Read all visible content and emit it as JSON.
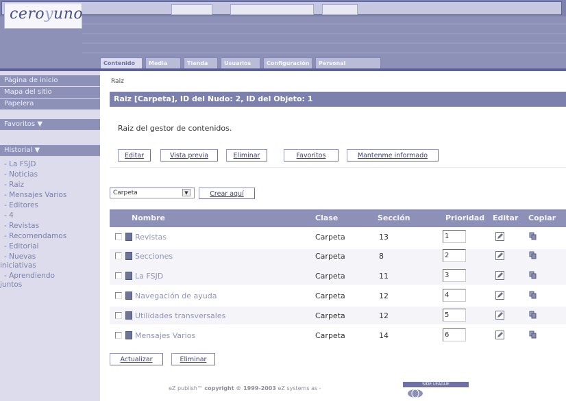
{
  "header": {
    "logo": {
      "brand_a": "cero",
      "brand_b": "y",
      "brand_c": "uno"
    }
  },
  "tabs": [
    {
      "label": "Contenido"
    },
    {
      "label": "Media"
    },
    {
      "label": "Tienda"
    },
    {
      "label": "Usuarios"
    },
    {
      "label": "Configuración"
    },
    {
      "label": "Personal"
    }
  ],
  "sidebar": {
    "top_items": [
      {
        "label": "Página de inicio"
      },
      {
        "label": "Mapa del sitio"
      },
      {
        "label": "Papelera"
      }
    ],
    "favorites_header": "Favoritos ▼",
    "history_header": "Historial ▼",
    "history_items": [
      {
        "label": "- La FSJD"
      },
      {
        "label": "- Noticias"
      },
      {
        "label": "- Raiz"
      },
      {
        "label": "- Mensajes Varios"
      },
      {
        "label": "- Editores"
      },
      {
        "label": "- 4"
      },
      {
        "label": "- Revistas"
      },
      {
        "label": "- Recomendamos"
      },
      {
        "label": "- Editorial"
      },
      {
        "label": "- Nuevas"
      },
      {
        "label": "iniciativas"
      },
      {
        "label": "- Aprendiendo"
      },
      {
        "label": "juntos"
      }
    ]
  },
  "main": {
    "breadcrumb": "Raiz",
    "path_title": "Raiz [Carpeta], ID del Nudo: 2, ID del Objeto: 1",
    "description": "Raiz del gestor de contenidos.",
    "buttons": {
      "edit": "Editar",
      "preview": "Vista previa",
      "delete": "Eliminar",
      "favorites": "Favoritos",
      "notify": "Mantenme informado"
    },
    "create": {
      "select_value": "Carpeta",
      "button": "Crear aquí"
    }
  },
  "table": {
    "headers": {
      "name": "Nombre",
      "class": "Clase",
      "section": "Sección",
      "priority": "Prioridad",
      "edit": "Editar",
      "copy": "Copiar"
    },
    "rows": [
      {
        "name": "Revistas",
        "clase": "Carpeta",
        "seccion": "13",
        "prioridad": "1"
      },
      {
        "name": "Secciones",
        "clase": "Carpeta",
        "seccion": "8",
        "prioridad": "2"
      },
      {
        "name": "La FSJD",
        "clase": "Carpeta",
        "seccion": "11",
        "prioridad": "3"
      },
      {
        "name": "Navegación de ayuda",
        "clase": "Carpeta",
        "seccion": "12",
        "prioridad": "4"
      },
      {
        "name": "Utilidades transversales",
        "clase": "Carpeta",
        "seccion": "12",
        "prioridad": "5"
      },
      {
        "name": "Mensajes Varios",
        "clase": "Carpeta",
        "seccion": "14",
        "prioridad": "6"
      }
    ],
    "actions": {
      "update": "Actualizar",
      "delete": "Eliminar"
    }
  },
  "footer": {
    "text_a": "eZ publish™ ",
    "text_b": "copyright © 1999-2003",
    "text_c": " eZ systems as - ",
    "logo_bar": "SIDE LEAGUE"
  },
  "colors": {
    "header": "#8d91b8",
    "path_bar": "#7b80ad",
    "sidebar": "#dcdcec",
    "link": "#8f93b8"
  }
}
